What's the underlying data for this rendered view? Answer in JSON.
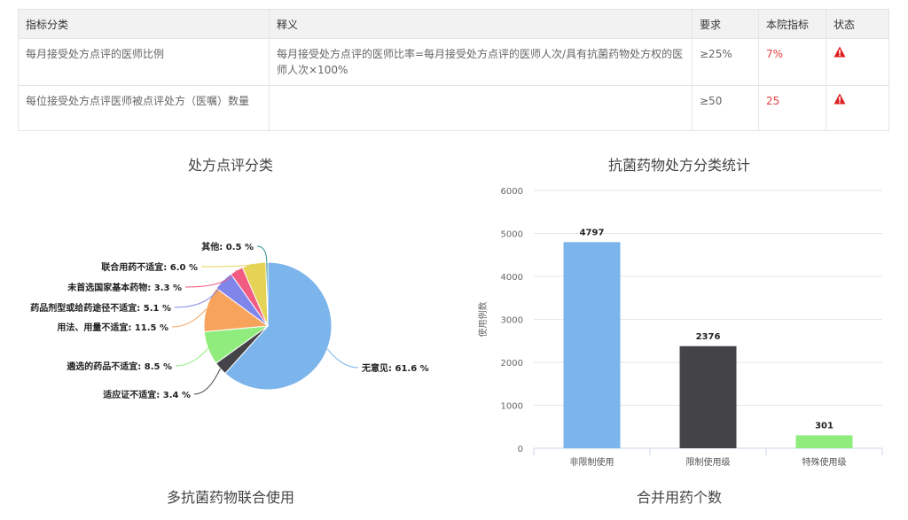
{
  "table": {
    "headers": [
      "指标分类",
      "释义",
      "要求",
      "本院指标",
      "状态"
    ],
    "rows": [
      {
        "category": "每月接受处方点评的医师比例",
        "definition": "每月接受处方点评的医师比率=每月接受处方点评的医师人次/具有抗菌药物处方权的医师人次×100%",
        "requirement": "≥25%",
        "value": "7%",
        "status": "warning-icon"
      },
      {
        "category": "每位接受处方点评医师被点评处方（医嘱）数量",
        "definition": "",
        "requirement": "≥50",
        "value": "25",
        "status": "warning-icon"
      }
    ]
  },
  "titles": {
    "pie": "处方点评分类",
    "bar": "抗菌药物处方分类统计",
    "bottom_left": "多抗菌药物联合使用",
    "bottom_right": "合并用药个数"
  },
  "colors": {
    "warning": "#e02020",
    "alert_value": "#e54040"
  },
  "chart_data": [
    {
      "type": "pie",
      "title": "处方点评分类",
      "slices": [
        {
          "label": "无意见",
          "value": 61.6,
          "text": "无意见: 61.6 %",
          "color": "#7cb5ec"
        },
        {
          "label": "适应证不适宜",
          "value": 3.4,
          "text": "适应证不适宜: 3.4 %",
          "color": "#434348"
        },
        {
          "label": "遴选的药品不适宜",
          "value": 8.5,
          "text": "遴选的药品不适宜: 8.5 %",
          "color": "#90ed7d"
        },
        {
          "label": "用法、用量不适宜",
          "value": 11.5,
          "text": "用法、用量不适宜: 11.5 %",
          "color": "#f7a35c"
        },
        {
          "label": "药品剂型或给药途径不适宜",
          "value": 5.1,
          "text": "药品剂型或给药途径不适宜: 5.1 %",
          "color": "#8085e9"
        },
        {
          "label": "未首选国家基本药物",
          "value": 3.3,
          "text": "未首选国家基本药物: 3.3 %",
          "color": "#f15c80"
        },
        {
          "label": "联合用药不适宜",
          "value": 6.0,
          "text": "联合用药不适宜: 6.0 %",
          "color": "#e4d354"
        },
        {
          "label": "其他",
          "value": 0.5,
          "text": "其他: 0.5 %",
          "color": "#2b908f"
        }
      ]
    },
    {
      "type": "bar",
      "title": "抗菌药物处方分类统计",
      "ylabel": "使用例数",
      "categories": [
        "非限制使用",
        "限制使用级",
        "特殊使用级"
      ],
      "values": [
        4797,
        2376,
        301
      ],
      "colors": [
        "#7cb5ec",
        "#434348",
        "#90ed7d"
      ],
      "ylim": [
        0,
        6000
      ],
      "yticks": [
        "0",
        "1000",
        "2000",
        "3000",
        "4000",
        "5000",
        "6000"
      ],
      "grid": true
    }
  ]
}
